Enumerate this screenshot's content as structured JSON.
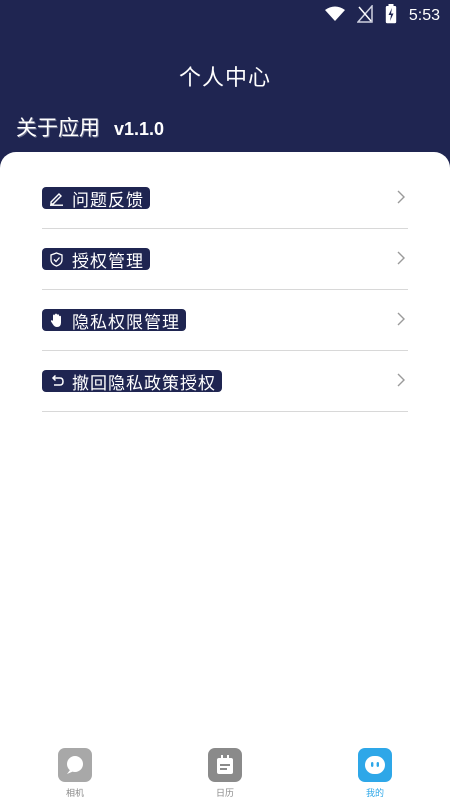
{
  "status": {
    "time": "5:53"
  },
  "header": {
    "title": "个人中心",
    "about_label": "关于应用",
    "version": "v1.1.0"
  },
  "menu": [
    {
      "label": "问题反馈",
      "icon": "edit-icon"
    },
    {
      "label": "授权管理",
      "icon": "shield-check-icon"
    },
    {
      "label": "隐私权限管理",
      "icon": "hand-icon"
    },
    {
      "label": "撤回隐私政策授权",
      "icon": "undo-icon"
    }
  ],
  "nav": [
    {
      "label": "相机",
      "icon": "camera-icon",
      "active": false
    },
    {
      "label": "日历",
      "icon": "calendar-icon",
      "active": false
    },
    {
      "label": "我的",
      "icon": "profile-icon",
      "active": true
    }
  ],
  "colors": {
    "primary": "#1f2551",
    "accent": "#2ea7e8",
    "nav_gray": "#a8a8a8"
  }
}
